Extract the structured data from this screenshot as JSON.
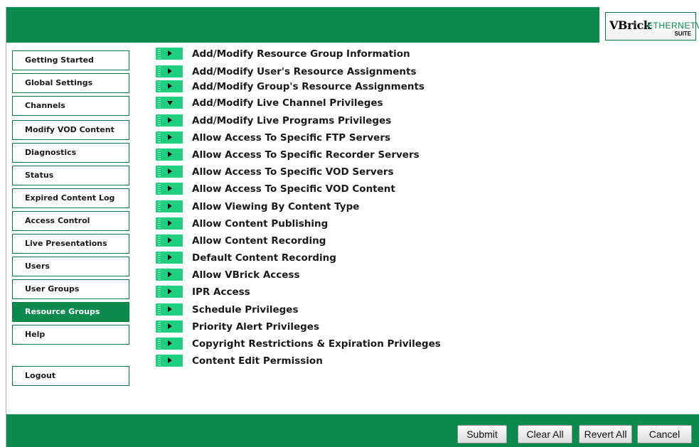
{
  "logo": {
    "brand": "VBrick",
    "product": "ETHERNETV",
    "suite": "SUITE"
  },
  "sidebar": {
    "items": [
      {
        "label": "Getting Started"
      },
      {
        "label": "Global Settings"
      },
      {
        "label": "Channels"
      },
      {
        "label": "Modify VOD Content"
      },
      {
        "label": "Diagnostics"
      },
      {
        "label": "Status"
      },
      {
        "label": "Expired Content Log"
      },
      {
        "label": "Access Control"
      },
      {
        "label": "Live Presentations"
      },
      {
        "label": "Users"
      },
      {
        "label": "User Groups"
      },
      {
        "label": "Resource Groups",
        "active": true
      },
      {
        "label": "Help"
      },
      {
        "label": "Logout"
      }
    ]
  },
  "menu": {
    "items": [
      {
        "label": "Add/Modify Resource Group Information",
        "expanded": false
      },
      {
        "label": "Add/Modify User's Resource Assignments",
        "expanded": false
      },
      {
        "label": "Add/Modify Group's Resource Assignments",
        "expanded": false
      },
      {
        "label": "Add/Modify Live Channel Privileges",
        "expanded": true
      },
      {
        "label": "Add/Modify Live Programs Privileges",
        "expanded": false
      },
      {
        "label": "Allow Access To Specific FTP Servers",
        "expanded": false
      },
      {
        "label": "Allow Access To Specific Recorder Servers",
        "expanded": false
      },
      {
        "label": "Allow Access To Specific VOD Servers",
        "expanded": false
      },
      {
        "label": "Allow Access To Specific VOD Content",
        "expanded": false
      },
      {
        "label": "Allow Viewing By Content Type",
        "expanded": false
      },
      {
        "label": "Allow Content Publishing",
        "expanded": false
      },
      {
        "label": "Allow Content Recording",
        "expanded": false
      },
      {
        "label": "Default Content Recording",
        "expanded": false
      },
      {
        "label": "Allow VBrick Access",
        "expanded": false
      },
      {
        "label": "IPR Access",
        "expanded": false
      },
      {
        "label": "Schedule Privileges",
        "expanded": false
      },
      {
        "label": "Priority Alert Privileges",
        "expanded": false
      },
      {
        "label": "Copyright Restrictions & Expiration Privileges",
        "expanded": false
      },
      {
        "label": "Content Edit Permission",
        "expanded": false
      }
    ]
  },
  "footer": {
    "submit_label": "Submit",
    "clear_all_label": "Clear All",
    "revert_all_label": "Revert All",
    "cancel_label": "Cancel"
  },
  "colors": {
    "brand_green": "#0a8a4c",
    "arrow_green": "#1fcf7f"
  }
}
